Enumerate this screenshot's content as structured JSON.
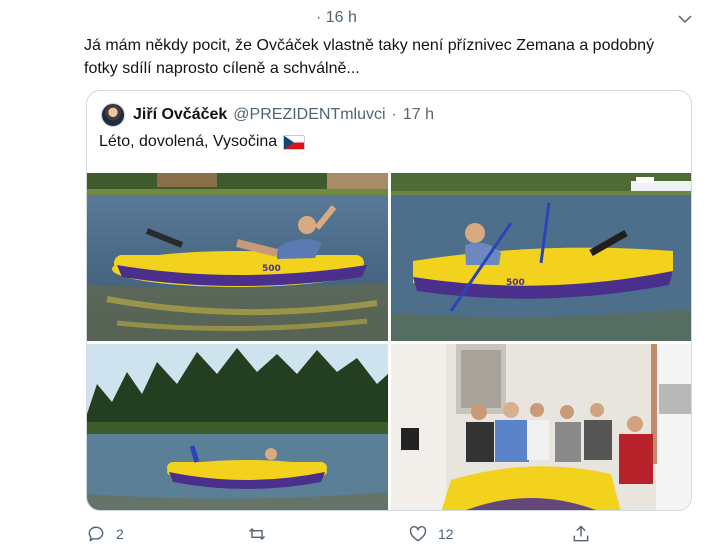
{
  "tweet": {
    "time": "· 16 h",
    "text": "Já mám někdy pocit, že Ovčáček vlastně taky není příznivec Zemana a podobný fotky sdílí naprosto cíleně a schválně..."
  },
  "quote": {
    "name": "Jiří Ovčáček",
    "handle": "@PREZIDENTmluvci",
    "dot": "·",
    "time": "17 h",
    "text": "Léto, dovolená, Vysočina",
    "flag": "czech-flag-emoji",
    "boat_label": "500"
  },
  "actions": {
    "reply_count": "2",
    "retweet_count": "",
    "like_count": "12"
  },
  "icons": {
    "reply": "reply-icon",
    "retweet": "retweet-icon",
    "like": "heart-icon",
    "share": "share-icon",
    "menu": "chevron-down-icon"
  },
  "colors": {
    "text": "#0f1419",
    "muted": "#536471",
    "border": "#cfd9de",
    "boat_yellow": "#f2d21c",
    "boat_purple": "#4b2f8c"
  }
}
